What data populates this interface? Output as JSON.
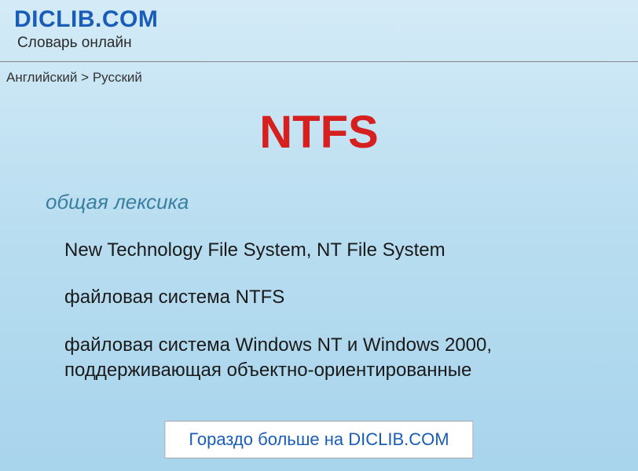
{
  "header": {
    "site_title": "DICLIB.COM",
    "subtitle": "Словарь онлайн"
  },
  "breadcrumb": {
    "from": "Английский",
    "separator": ">",
    "to": "Русский"
  },
  "entry": {
    "title": "NTFS",
    "category": "общая лексика",
    "definitions": [
      "New Technology File System, NT File System",
      "файловая система NTFS",
      "файловая система Windows NT и Windows 2000, поддерживающая объектно-ориентированные"
    ]
  },
  "footer": {
    "more_button": "Гораздо больше на DICLIB.COM"
  }
}
